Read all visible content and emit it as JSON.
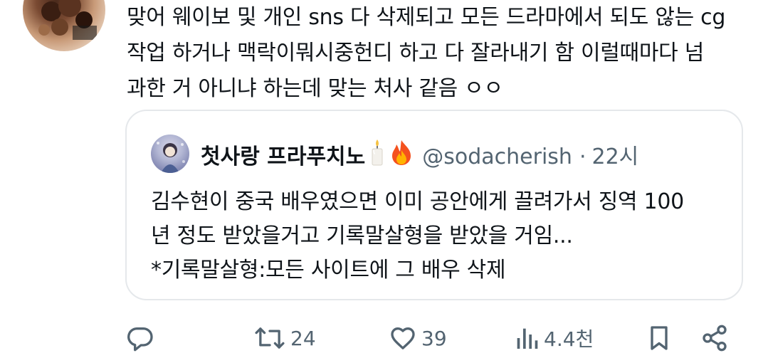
{
  "tweet": {
    "text": "맞어 웨이보 및 개인 sns 다 삭제되고 모든 드라마에서 되도 않는 cg\n작업 하거나 맥락이뭐시중헌디 하고 다 잘라내기 함 이럴때마다 넘\n과한 거 아니냐 하는데 맞는 처사 같음 ㅇㅇ"
  },
  "quote": {
    "display_name": "첫사랑 프라푸치노",
    "handle": "@sodacherish",
    "separator": "·",
    "time": "22시",
    "name_emojis": [
      "candle-icon",
      "fire-icon"
    ],
    "text": "김수현이 중국 배우였으면 이미 공안에게 끌려가서 징역 100\n년 정도 받았을거고 기록말살형을 받았을 거임...\n*기록말살형:모든 사이트에 그 배우 삭제"
  },
  "actions": {
    "reply": {
      "icon": "reply-icon"
    },
    "retweet": {
      "icon": "retweet-icon",
      "count": "24"
    },
    "like": {
      "icon": "heart-icon",
      "count": "39"
    },
    "views": {
      "icon": "views-icon",
      "count": "4.4천"
    },
    "bookmark": {
      "icon": "bookmark-icon"
    },
    "share": {
      "icon": "share-icon"
    }
  },
  "colors": {
    "text": "#0f1419",
    "secondary": "#536471",
    "border": "#e5e8eb",
    "background": "#ffffff"
  }
}
